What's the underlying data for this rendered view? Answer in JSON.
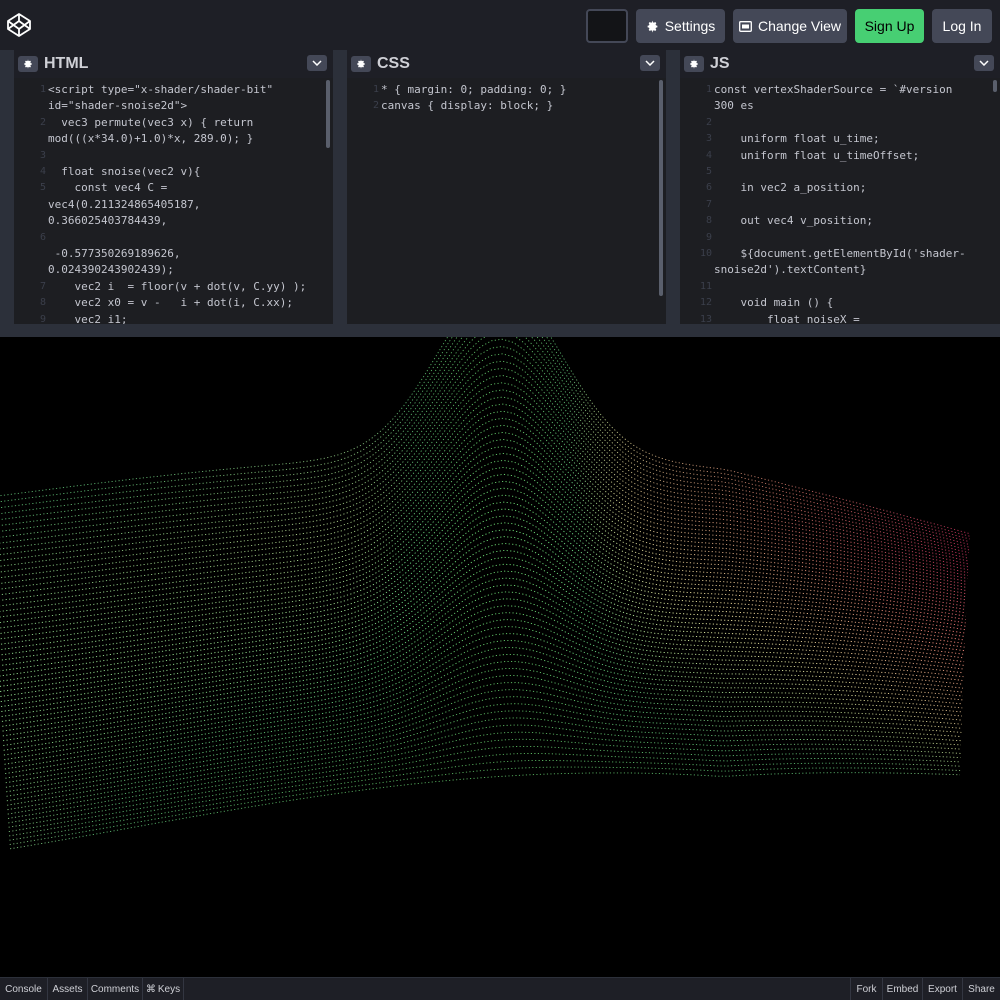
{
  "header": {
    "settings_label": "Settings",
    "change_view_label": "Change View",
    "signup_label": "Sign Up",
    "login_label": "Log In"
  },
  "panels": {
    "html": {
      "title": "HTML",
      "lines": [
        {
          "n": "1",
          "t": "<script type=\"x-shader/shader-bit\""
        },
        {
          "n": "",
          "t": "id=\"shader-snoise2d\">"
        },
        {
          "n": "2",
          "t": "  vec3 permute(vec3 x) { return"
        },
        {
          "n": "",
          "t": "mod(((x*34.0)+1.0)*x, 289.0); }"
        },
        {
          "n": "3",
          "t": ""
        },
        {
          "n": "4",
          "t": "  float snoise(vec2 v){"
        },
        {
          "n": "5",
          "t": "    const vec4 C ="
        },
        {
          "n": "",
          "t": "vec4(0.211324865405187,"
        },
        {
          "n": "",
          "t": "0.366025403784439,"
        },
        {
          "n": "6",
          "t": ""
        },
        {
          "n": "",
          "t": " -0.577350269189626,"
        },
        {
          "n": "",
          "t": "0.024390243902439);"
        },
        {
          "n": "7",
          "t": "    vec2 i  = floor(v + dot(v, C.yy) );"
        },
        {
          "n": "8",
          "t": "    vec2 x0 = v -   i + dot(i, C.xx);"
        },
        {
          "n": "9",
          "t": "    vec2 i1;"
        }
      ]
    },
    "css": {
      "title": "CSS",
      "lines": [
        {
          "n": "1",
          "t": "* { margin: 0; padding: 0; }"
        },
        {
          "n": "2",
          "t": "canvas { display: block; }"
        }
      ]
    },
    "js": {
      "title": "JS",
      "lines": [
        {
          "n": "1",
          "t": "const vertexShaderSource = `#version"
        },
        {
          "n": "",
          "t": "300 es"
        },
        {
          "n": "2",
          "t": ""
        },
        {
          "n": "3",
          "t": "    uniform float u_time;"
        },
        {
          "n": "4",
          "t": "    uniform float u_timeOffset;"
        },
        {
          "n": "5",
          "t": ""
        },
        {
          "n": "6",
          "t": "    in vec2 a_position;"
        },
        {
          "n": "7",
          "t": ""
        },
        {
          "n": "8",
          "t": "    out vec4 v_position;"
        },
        {
          "n": "9",
          "t": ""
        },
        {
          "n": "10",
          "t": "    ${document.getElementById('shader-"
        },
        {
          "n": "",
          "t": "snoise2d').textContent}"
        },
        {
          "n": "11",
          "t": ""
        },
        {
          "n": "12",
          "t": "    void main () {"
        },
        {
          "n": "13",
          "t": "        float noiseX ="
        }
      ]
    }
  },
  "footer": {
    "console": "Console",
    "assets": "Assets",
    "comments": "Comments",
    "keys": "Keys",
    "fork": "Fork",
    "embed": "Embed",
    "export": "Export",
    "share": "Share"
  },
  "colors": {
    "accent_green": "#47cf73",
    "button_gray": "#444857",
    "header_bg": "#1e1f26",
    "editor_bg": "#1d1e22"
  }
}
